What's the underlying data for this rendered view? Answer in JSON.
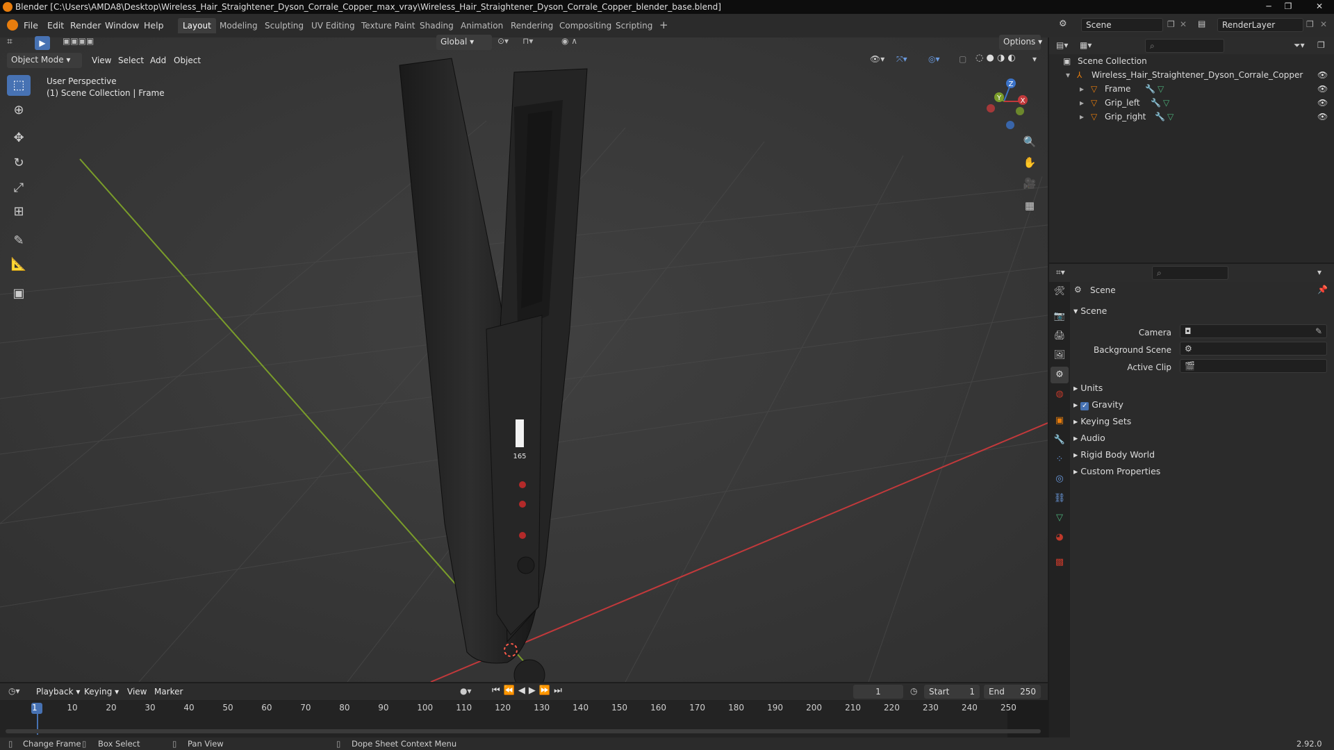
{
  "window": {
    "title": "Blender [C:\\Users\\AMDA8\\Desktop\\Wireless_Hair_Straightener_Dyson_Corrale_Copper_max_vray\\Wireless_Hair_Straightener_Dyson_Corrale_Copper_blender_base.blend]",
    "minimize": "─",
    "maximize": "❐",
    "close": "✕"
  },
  "menu": [
    "File",
    "Edit",
    "Render",
    "Window",
    "Help"
  ],
  "workspaces": [
    "Layout",
    "Modeling",
    "Sculpting",
    "UV Editing",
    "Texture Paint",
    "Shading",
    "Animation",
    "Rendering",
    "Compositing",
    "Scripting"
  ],
  "add_workspace": "+",
  "scene_field": "Scene",
  "renderlayer_field": "RenderLayer",
  "viewport": {
    "mode": "Object Mode",
    "menus": [
      "View",
      "Select",
      "Add",
      "Object"
    ],
    "transform_orientation": "Global",
    "options": "Options",
    "overlay_line1": "User Perspective",
    "overlay_line2": "(1) Scene Collection | Frame",
    "gizmo": {
      "x": "X",
      "y": "Y",
      "z": "Z"
    },
    "device_display": "165"
  },
  "outliner": {
    "root": "Scene Collection",
    "collection": "Wireless_Hair_Straightener_Dyson_Corrale_Copper",
    "objects": [
      "Frame",
      "Grip_left",
      "Grip_right"
    ]
  },
  "properties": {
    "header": "Scene",
    "panel": "Scene",
    "fields": [
      {
        "label": "Camera",
        "value": ""
      },
      {
        "label": "Background Scene",
        "value": ""
      },
      {
        "label": "Active Clip",
        "value": ""
      }
    ],
    "subpanels": [
      "Units",
      "Gravity",
      "Keying Sets",
      "Audio",
      "Rigid Body World",
      "Custom Properties"
    ],
    "gravity_checked": true
  },
  "timeline": {
    "menus": [
      "Playback",
      "Keying",
      "View",
      "Marker"
    ],
    "current_frame": "1",
    "start_label": "Start",
    "start": "1",
    "end_label": "End",
    "end": "250",
    "ticks": [
      "1",
      "10",
      "20",
      "30",
      "40",
      "50",
      "60",
      "70",
      "80",
      "90",
      "100",
      "110",
      "120",
      "130",
      "140",
      "150",
      "160",
      "170",
      "180",
      "190",
      "200",
      "210",
      "220",
      "230",
      "240",
      "250"
    ]
  },
  "status": {
    "hints": [
      "Change Frame",
      "Box Select",
      "Pan View",
      "Dope Sheet Context Menu"
    ],
    "version": "2.92.0"
  },
  "colors": {
    "accent": "#4772b3",
    "x_axis": "#c2393b",
    "y_axis": "#7a9d2a",
    "z_axis": "#3b72c7",
    "blender_orange": "#e87d0d"
  }
}
